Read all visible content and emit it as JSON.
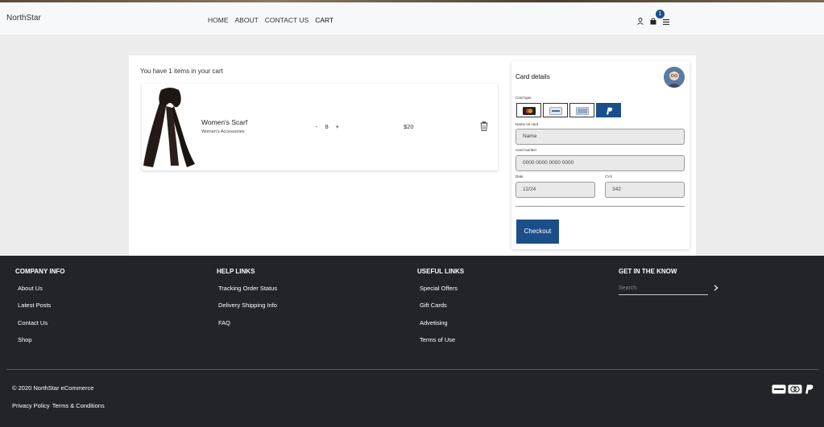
{
  "brand": "NorthStar",
  "nav": {
    "items": [
      "HOME",
      "ABOUT",
      "CONTACT US",
      "CART"
    ]
  },
  "header": {
    "cart_badge": "1"
  },
  "cart": {
    "count_text": "You have 1 items in your cart",
    "item": {
      "name": "Women's Scarf",
      "category": "Women's Accessories",
      "qty_minus": "-",
      "qty": "8",
      "qty_plus": "+",
      "price": "$20"
    }
  },
  "card_details": {
    "title": "Card details",
    "card_type_label": "Card type",
    "name_label": "Name on card",
    "name_value": "Name",
    "number_label": "Card number",
    "number_value": "0000 0000 0000 0000",
    "date_label": "Date",
    "date_value": "12/24",
    "cvv_label": "CVV",
    "cvv_value": "342",
    "checkout_label": "Checkout",
    "accent_color": "#1a4f8a"
  },
  "footer": {
    "company": {
      "heading": "COMPANY INFO",
      "links": [
        "About Us",
        "Latest Posts",
        "Contact Us",
        "Shop"
      ]
    },
    "help": {
      "heading": "HELP LINKS",
      "links": [
        "Tracking Order Status",
        "Delivery Shipping Info",
        "FAQ"
      ]
    },
    "useful": {
      "heading": "USEFUL LINKS",
      "links": [
        "Special Offers",
        "Gift Cards",
        "Advetising",
        "Terms of Use"
      ]
    },
    "know": {
      "heading": "GET IN THE KNOW",
      "search_placeholder": "Search"
    },
    "copyright": "© 2020 NorthStar eCommerce",
    "privacy": "Privacy Policy",
    "terms": "Terms & Conditions",
    "background": "#212529"
  }
}
